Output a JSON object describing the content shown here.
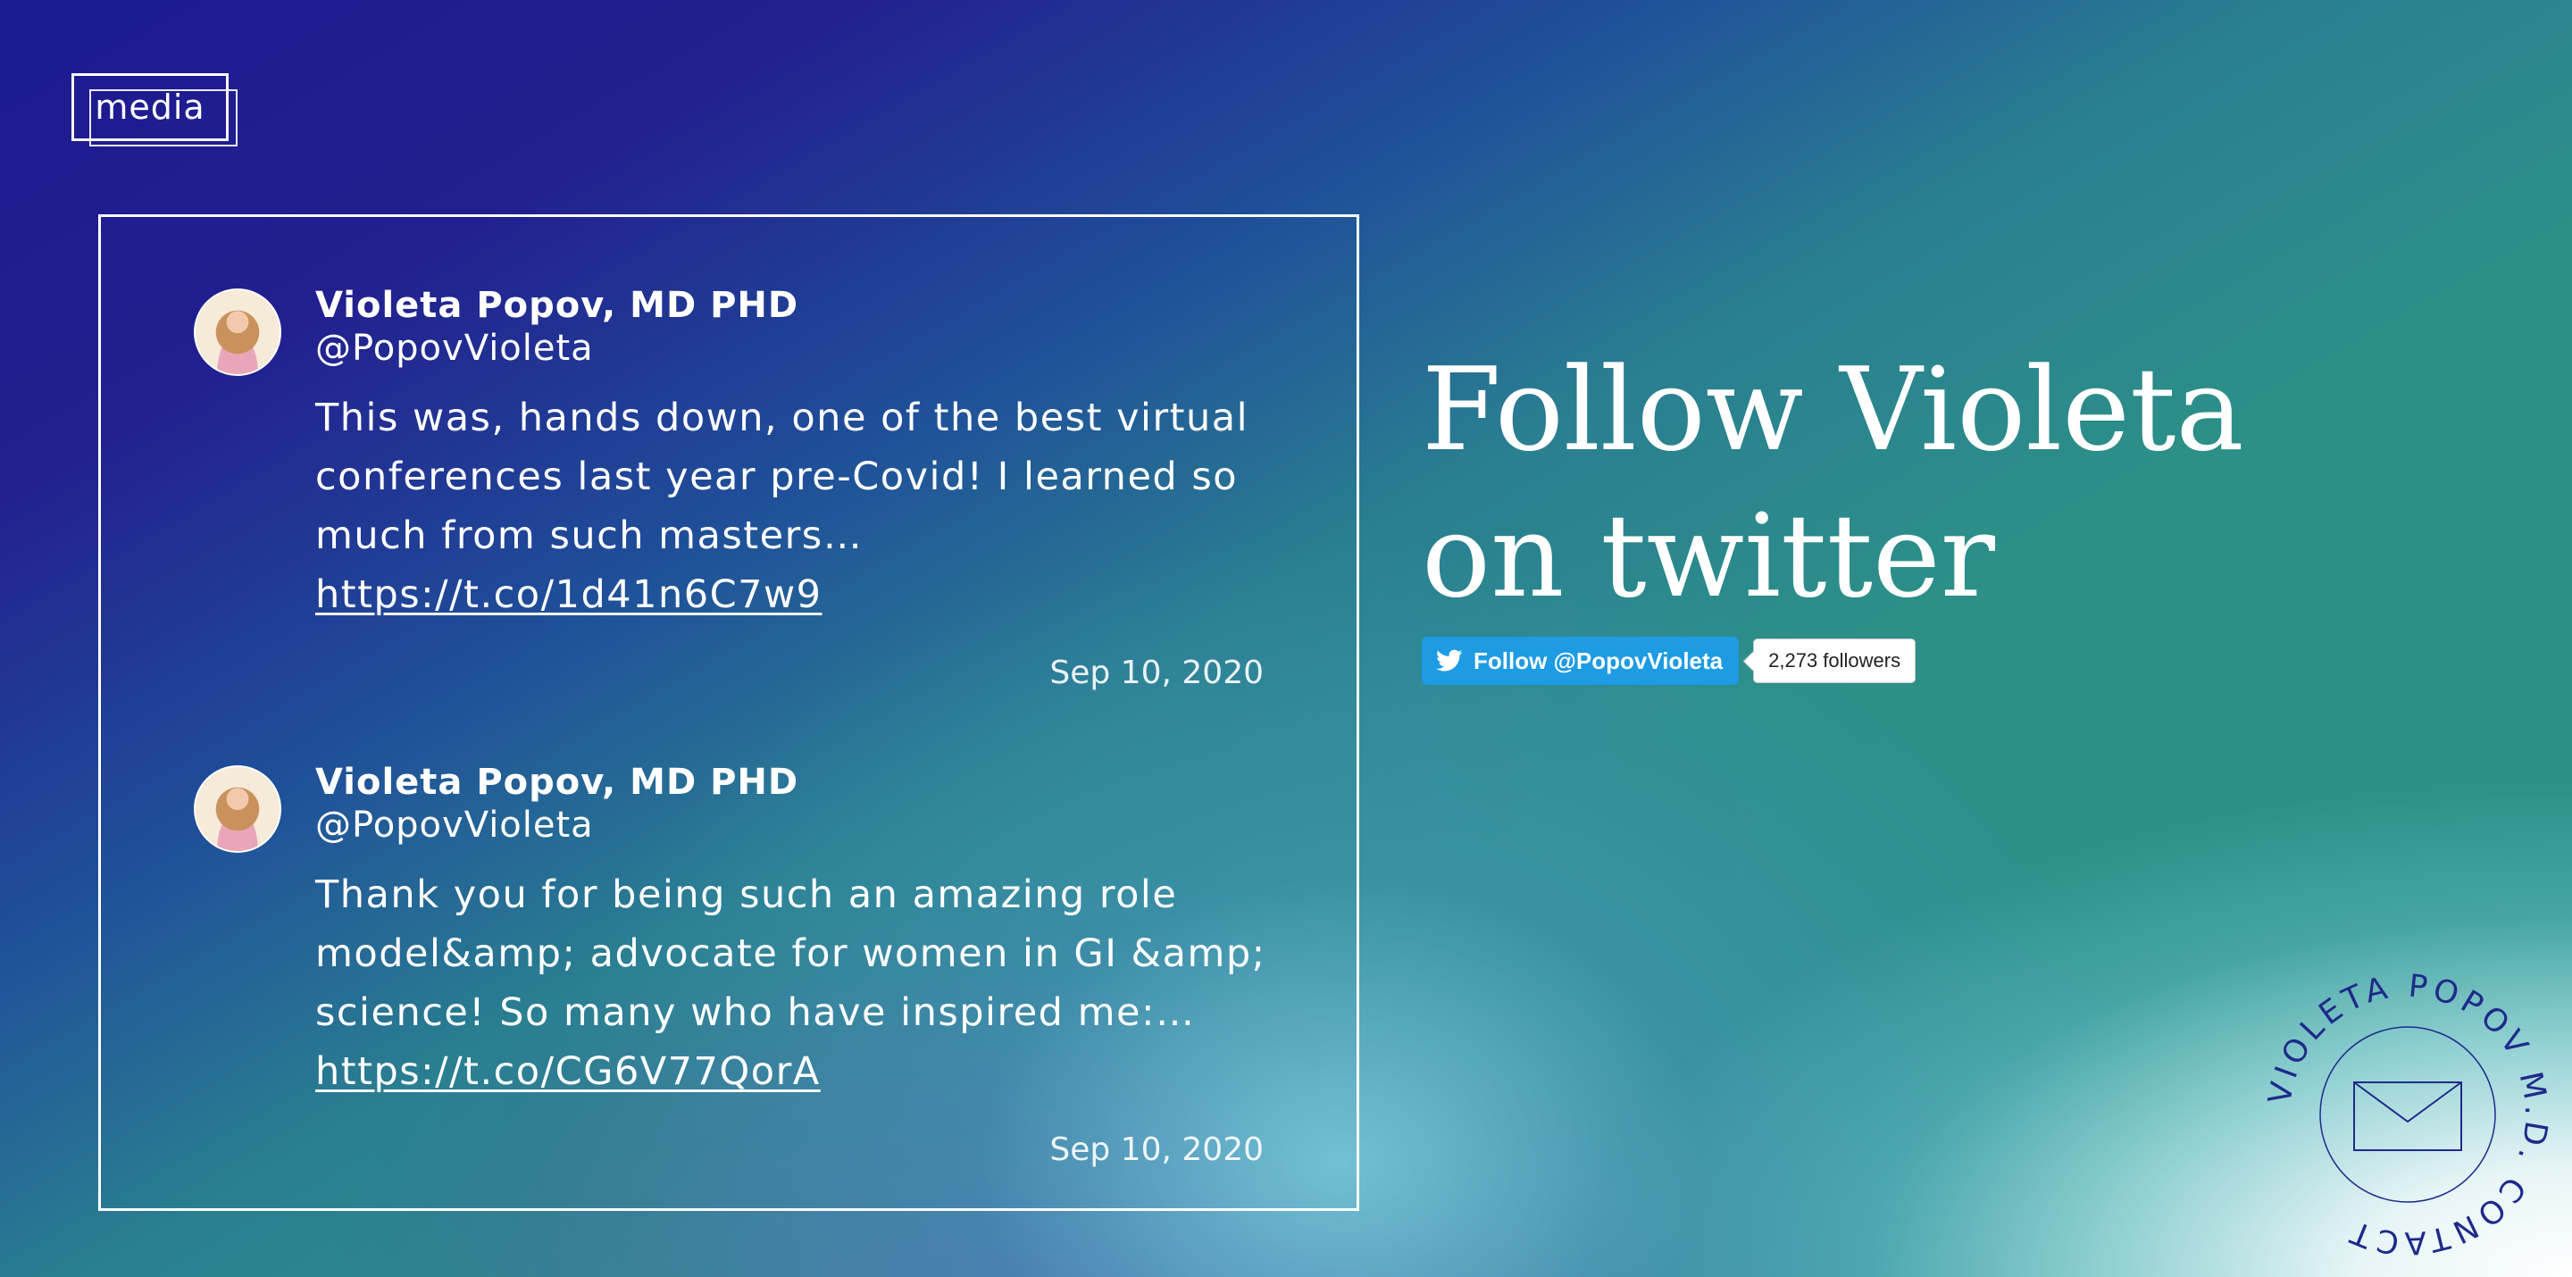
{
  "media_tag": {
    "label": "media"
  },
  "tweets": [
    {
      "name": "Violeta Popov, MD PHD",
      "handle": "@PopovVioleta",
      "text": "This was, hands down, one of the best virtual conferences last year pre-Covid! I learned so much from such masters…",
      "link": "https://t.co/1d41n6C7w9",
      "date": "Sep 10, 2020"
    },
    {
      "name": "Violeta Popov, MD PHD",
      "handle": "@PopovVioleta",
      "text": "Thank you for being such an amazing role model&amp; advocate for women in GI &amp; science! So many who have inspired me:…",
      "link": "https://t.co/CG6V77QorA",
      "date": "Sep 10, 2020"
    }
  ],
  "follow": {
    "heading": "Follow Violeta on twitter",
    "button_label": "Follow @PopovVioleta",
    "followers": "2,273 followers"
  },
  "contact_badge": {
    "ring_text": "VIOLETA POPOV M.D. CONTACT"
  },
  "colors": {
    "twitter_blue": "#1d9be3",
    "badge_navy": "#1f2a8a"
  },
  "icons": {
    "twitter": "twitter-bird-icon",
    "contact": "envelope-icon"
  }
}
